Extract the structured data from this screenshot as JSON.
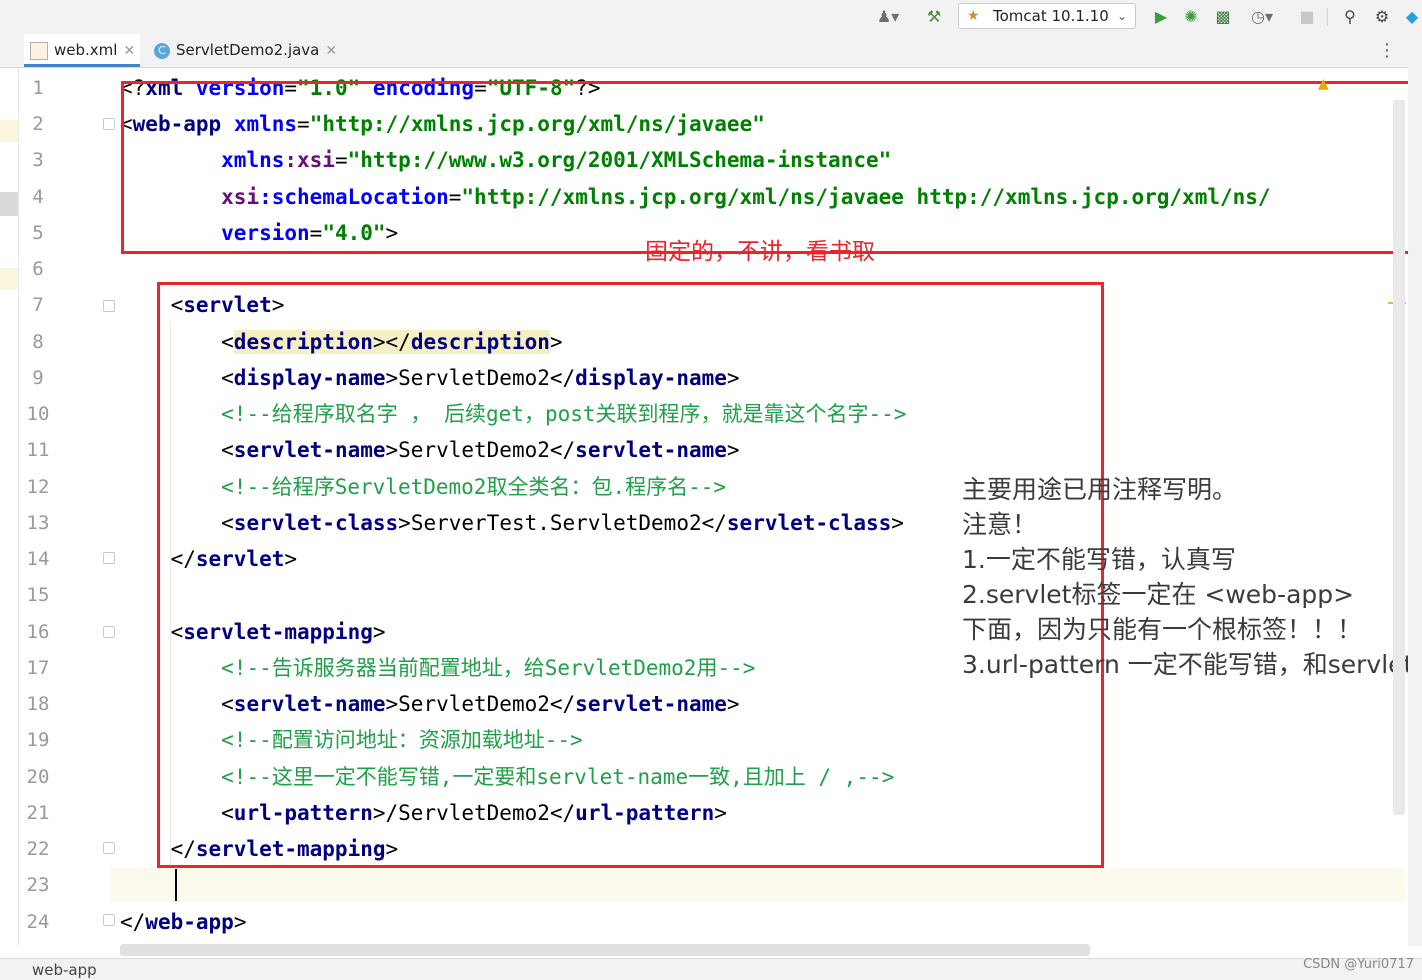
{
  "toolbar": {
    "run_config": "Tomcat 10.1.10",
    "icons": [
      "user-icon",
      "build-hammer-icon",
      "tomcat-icon",
      "run-icon",
      "debug-icon",
      "coverage-icon",
      "profile-icon",
      "stop-icon",
      "search-icon",
      "settings-icon",
      "toolbox-icon"
    ]
  },
  "tabs": [
    {
      "label": "web.xml",
      "icon": "xml-file-icon",
      "active": true
    },
    {
      "label": "ServletDemo2.java",
      "icon": "java-class-icon",
      "active": false
    }
  ],
  "editor": {
    "line_numbers": [
      "1",
      "2",
      "3",
      "4",
      "5",
      "6",
      "7",
      "8",
      "9",
      "10",
      "11",
      "12",
      "13",
      "14",
      "15",
      "16",
      "17",
      "18",
      "19",
      "20",
      "21",
      "22",
      "23",
      "24"
    ],
    "lines": {
      "l1": {
        "a": "<?",
        "b": "xml ",
        "c": "version",
        "d": "=",
        "e": "\"1.0\"",
        "f": " ",
        "g": "encoding",
        "h": "=",
        "i": "\"UTF-8\"",
        "j": "?>"
      },
      "l2": {
        "a": "<",
        "b": "web-app",
        "c": " ",
        "d": "xmlns",
        "e": "=",
        "f": "\"http://xmlns.jcp.org/xml/ns/javaee\""
      },
      "l3": {
        "a": "        ",
        "b": "xmlns",
        "c": ":xsi",
        "d": "=",
        "e": "\"http://www.w3.org/2001/XMLSchema-instance\""
      },
      "l4": {
        "a": "        ",
        "b": "xsi",
        "c": ":schemaLocation",
        "d": "=",
        "e": "\"http://xmlns.jcp.org/xml/ns/javaee http://xmlns.jcp.org/xml/ns/"
      },
      "l5": {
        "a": "        ",
        "b": "version",
        "c": "=",
        "d": "\"4.0\"",
        "e": ">"
      },
      "l7": {
        "a": "    <",
        "b": "servlet",
        "c": ">"
      },
      "l8": {
        "a": "        <",
        "b": "description",
        "c": "></",
        "d": "description",
        "e": ">"
      },
      "l9": {
        "a": "        <",
        "b": "display-name",
        "c": ">ServletDemo2</",
        "d": "display-name",
        "e": ">"
      },
      "l10": {
        "a": "        ",
        "b": "<!--给程序取名字 ， 后续get，post关联到程序，就是靠这个名字-->"
      },
      "l11": {
        "a": "        <",
        "b": "servlet-name",
        "c": ">ServletDemo2</",
        "d": "servlet-name",
        "e": ">"
      },
      "l12": {
        "a": "        ",
        "b": "<!--给程序ServletDemo2取全类名：包.程序名-->"
      },
      "l13": {
        "a": "        <",
        "b": "servlet-class",
        "c": ">ServerTest.ServletDemo2</",
        "d": "servlet-class",
        "e": ">"
      },
      "l14": {
        "a": "    </",
        "b": "servlet",
        "c": ">"
      },
      "l16": {
        "a": "    <",
        "b": "servlet-mapping",
        "c": ">"
      },
      "l17": {
        "a": "        ",
        "b": "<!--告诉服务器当前配置地址，给ServletDemo2用-->"
      },
      "l18": {
        "a": "        <",
        "b": "servlet-name",
        "c": ">ServletDemo2</",
        "d": "servlet-name",
        "e": ">"
      },
      "l19": {
        "a": "        ",
        "b": "<!--配置访问地址：资源加载地址-->"
      },
      "l20": {
        "a": "        ",
        "b": "<!--这里一定不能写错,一定要和servlet-name一致,且加上 / ,-->"
      },
      "l21": {
        "a": "        <",
        "b": "url-pattern",
        "c": ">/ServletDemo2</",
        "d": "url-pattern",
        "e": ">"
      },
      "l22": {
        "a": "    </",
        "b": "servlet-mapping",
        "c": ">"
      },
      "l24": {
        "a": "</",
        "b": "web-app",
        "c": ">"
      }
    }
  },
  "annotations": {
    "red_note": "固定的，不讲，看书取",
    "notes": [
      "主要用途已用注释写明。",
      "注意！",
      "1.一定不能写错，认真写",
      "2.servlet标签一定在 <web-app>",
      "下面，因为只能有一个根标签！！！",
      "3.url-pattern 一定不能写错，和servlet-"
    ],
    "box_color": "#e8262b"
  },
  "status": {
    "breadcrumb": "web-app",
    "watermark": "CSDN @Yuri0717"
  }
}
